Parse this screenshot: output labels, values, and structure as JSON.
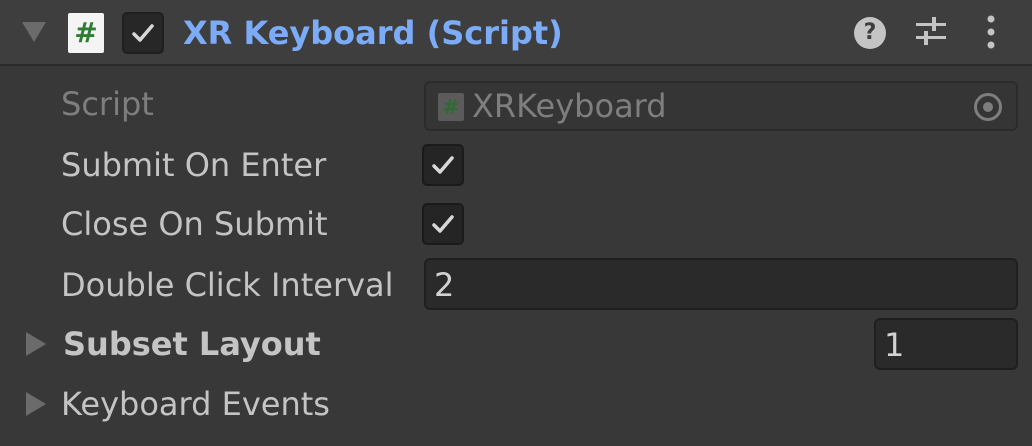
{
  "header": {
    "title": "XR Keyboard (Script)",
    "script_icon_glyph": "#",
    "enabled": true,
    "icons": [
      "foldout-expanded-icon",
      "script-icon",
      "checkmark-icon",
      "help-icon",
      "presets-icon",
      "context-menu-icon"
    ]
  },
  "fields": {
    "script": {
      "label": "Script",
      "value": "XRKeyboard",
      "icon_glyph": "#"
    },
    "submit_on_enter": {
      "label": "Submit On Enter",
      "checked": true
    },
    "close_on_submit": {
      "label": "Close On Submit",
      "checked": true
    },
    "double_click_interval": {
      "label": "Double Click Interval",
      "value": "2"
    },
    "subset_layout": {
      "label": "Subset Layout",
      "value": "1"
    },
    "keyboard_events": {
      "label": "Keyboard Events"
    }
  },
  "colors": {
    "background": "#383838",
    "header_background": "#3e3e3e",
    "title_accent": "#7cacf8",
    "label_text": "#c4c4c4",
    "disabled_text": "#7e7e7e",
    "script_green": "#2e7d32"
  }
}
